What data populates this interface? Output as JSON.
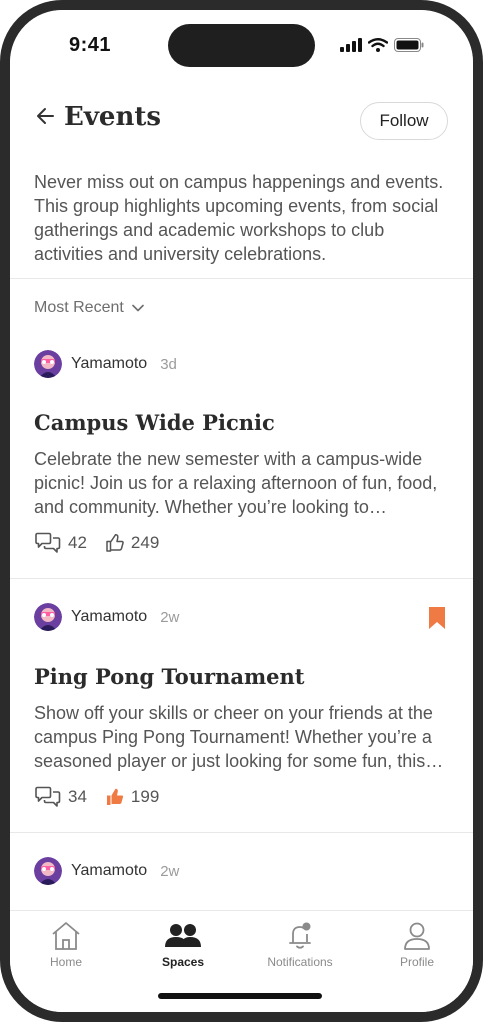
{
  "status": {
    "time": "9:41"
  },
  "header": {
    "title": "Events",
    "follow_label": "Follow"
  },
  "description": "Never miss out on campus happenings and events. This group highlights upcoming events, from social gatherings and academic workshops to club activities and university celebrations.",
  "sort": {
    "label": "Most Recent"
  },
  "posts": [
    {
      "author": "Yamamoto",
      "age": "3d",
      "title": "Campus Wide Picnic",
      "body": "Celebrate the new semester with a campus-wide picnic! Join us for a relaxing afternoon of fun, food, and community. Whether you’re looking to…",
      "comments": "42",
      "likes": "249",
      "liked": false,
      "bookmarked": false
    },
    {
      "author": "Yamamoto",
      "age": "2w",
      "title": "Ping Pong Tournament",
      "body": "Show off your skills or cheer on your friends at the campus Ping Pong Tournament! Whether you’re a seasoned player or just looking for some fun, this…",
      "comments": "34",
      "likes": "199",
      "liked": true,
      "bookmarked": true
    },
    {
      "author": "Yamamoto",
      "age": "2w"
    }
  ],
  "tabs": [
    {
      "label": "Home",
      "icon": "home-icon"
    },
    {
      "label": "Spaces",
      "icon": "people-icon",
      "active": true
    },
    {
      "label": "Notifications",
      "icon": "bell-icon"
    },
    {
      "label": "Profile",
      "icon": "person-icon"
    }
  ],
  "colors": {
    "accent": "#f07a43",
    "text": "#2b2b2b",
    "muted": "#8a8a8a"
  }
}
